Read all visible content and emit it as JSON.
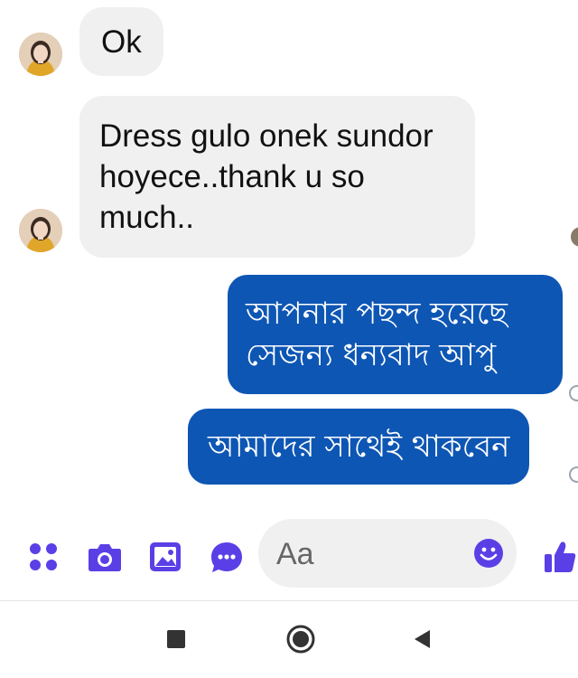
{
  "conversation": {
    "incoming": [
      {
        "text": "Ok"
      },
      {
        "text": "Dress gulo onek sundor hoyece..thank u so much.."
      }
    ],
    "outgoing": [
      {
        "text": "আপনার পছন্দ হয়েছে সেজন্য ধন্যবাদ আপু"
      },
      {
        "text": "আমাদের সাথেই থাকবেন"
      }
    ]
  },
  "composer": {
    "placeholder": "Aa",
    "icons": {
      "menu": "apps-icon",
      "camera": "camera-icon",
      "gallery": "image-icon",
      "chat": "chat-bubble-icon",
      "emoji": "emoji-icon",
      "like": "thumbs-up-icon"
    }
  },
  "navigation": {
    "icons": [
      "recent-apps-icon",
      "home-icon",
      "back-icon"
    ]
  },
  "colors": {
    "accent": "#5b3fe6",
    "outgoing_bubble": "#0d56b4",
    "incoming_bubble": "#f0f0f1"
  }
}
